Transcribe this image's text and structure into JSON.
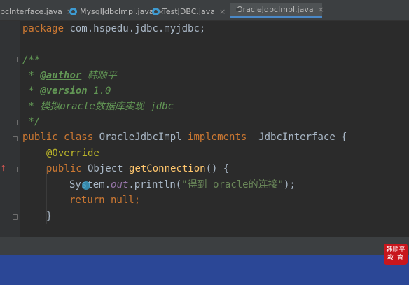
{
  "tabs": [
    {
      "label": "bcInterface.java",
      "icon": "java-interface-icon",
      "active": false
    },
    {
      "label": "MysqlJdbcImpl.java",
      "icon": "java-class-icon",
      "active": false
    },
    {
      "label": "TestJDBC.java",
      "icon": "java-class-icon",
      "active": false
    },
    {
      "label": "OracleJdbcImpl.java",
      "icon": "java-class-icon",
      "active": true
    }
  ],
  "tab_close_glyph": "×",
  "code": {
    "package_kw": "package",
    "package_name": " com.hspedu.jdbc.myjdbc;",
    "doc_open": "/**",
    "author_prefix": " * ",
    "author_tag": "@author",
    "author_value": " 韩顺平",
    "version_prefix": " * ",
    "version_tag": "@version",
    "version_value": " 1.0",
    "desc": " * 模拟oracle数据库实现 jdbc",
    "doc_close": " */",
    "class_kw": "public class",
    "class_name": " OracleJdbcImpl ",
    "implements_kw": "implements",
    "interface_name": "  JdbcInterface {",
    "override": "@Override",
    "method_kw": "public",
    "method_type": " Object ",
    "method_name": "getConnection",
    "method_rest": "() {",
    "stmt_obj": "System.",
    "stmt_field": "out",
    "stmt_call": ".println(",
    "stmt_str": "\"得到 oracle的连接\"",
    "stmt_end": ");",
    "return_kw": "return null",
    "return_end": ";",
    "close_brace": "}"
  },
  "watermark": {
    "line1": "韩顺平",
    "line2": "教育"
  },
  "colors": {
    "editor_bg": "#2b2b2b",
    "keyword": "#cc7832",
    "comment": "#629755",
    "string": "#6a8759",
    "method": "#ffc66d",
    "annotation": "#bbb529",
    "active_tab_underline": "#4a88c7",
    "video_band": "#2b4796",
    "logo_red": "#c8161d"
  }
}
